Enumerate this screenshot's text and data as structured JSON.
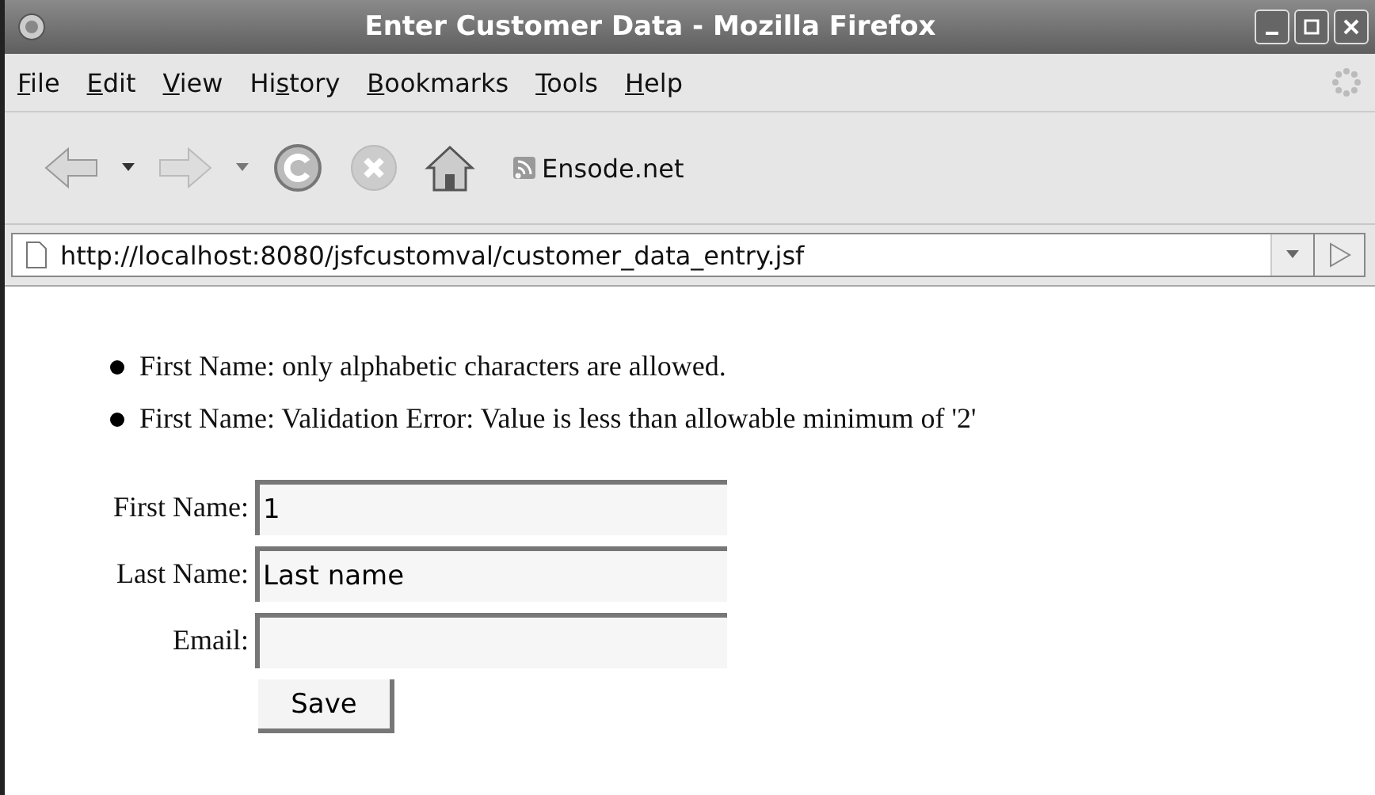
{
  "window": {
    "title": "Enter Customer Data - Mozilla Firefox"
  },
  "menu": [
    {
      "underlined": "F",
      "rest": "ile"
    },
    {
      "underlined": "E",
      "rest": "dit"
    },
    {
      "underlined": "V",
      "rest": "iew"
    },
    {
      "lead": "Hi",
      "underlined": "s",
      "rest": "tory"
    },
    {
      "underlined": "B",
      "rest": "ookmarks"
    },
    {
      "underlined": "T",
      "rest": "ools"
    },
    {
      "underlined": "H",
      "rest": "elp"
    }
  ],
  "toolbar": {
    "bookmark": "Ensode.net"
  },
  "address": {
    "value": "http://localhost:8080/jsfcustomval/customer_data_entry.jsf"
  },
  "errors": [
    "First Name: only alphabetic characters are allowed.",
    "First Name: Validation Error: Value is less than allowable minimum of '2'"
  ],
  "form": {
    "fields": [
      {
        "label": "First Name:",
        "value": "1"
      },
      {
        "label": "Last Name:",
        "value": "Last name"
      },
      {
        "label": "Email:"
      }
    ],
    "button": "Save"
  }
}
